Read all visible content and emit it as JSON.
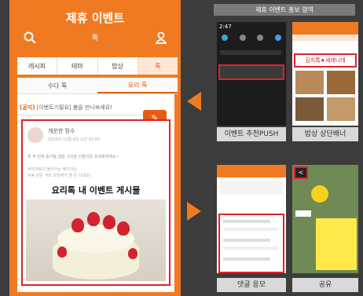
{
  "left_phone": {
    "title": "제휴 이벤트",
    "search_center": "톡",
    "categories": [
      "레시피",
      "테마",
      "밥상",
      "톡"
    ],
    "tabs": [
      "수다 톡",
      "요리 톡"
    ],
    "notice_tag": "[공지]",
    "notice_text": "[이벤트기필요] 봄을 만나보세요!",
    "post_user": "개운한 밍수",
    "post_date": "2015년 11월 4일 오전 00:00",
    "post_line1": "첫 주 전에 동거들 결말 고민을 안들어준 프레제에게요~",
    "post_line2": "버터크림이 들어가는 케이크는",
    "post_line3": "처음 만든 거라 모양새가 영 안 나네요!",
    "overlay_caption": "요리톡 내 이벤트 게시물"
  },
  "right_panel": {
    "title": "제휴 이벤트 홍보 영역",
    "captions": [
      "이벤트 추천PUSH",
      "밥상 상단배너",
      "댓글 응모",
      "공유"
    ],
    "push_time": "2:47",
    "banner_text": "김치톡★셰레니데"
  },
  "colors": {
    "accent": "#f07a22",
    "red_box": "#e3202b"
  }
}
